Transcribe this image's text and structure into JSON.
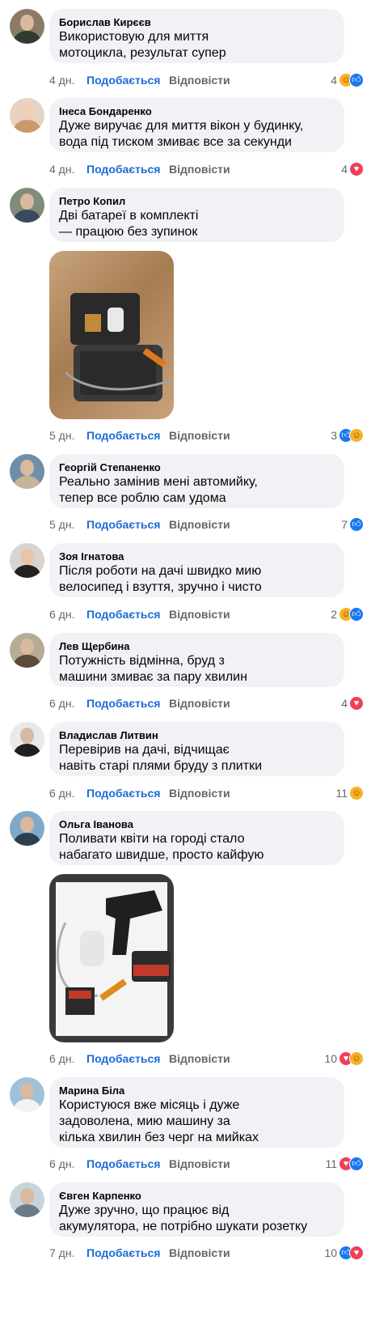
{
  "actions": {
    "like": "Подобається",
    "reply": "Відповісти"
  },
  "colors": {
    "link": "#1e6bd6",
    "bubble": "#f0f2f5",
    "meta": "#65676b",
    "like": "#1877f2",
    "love": "#f33e58",
    "care": "#f7b125"
  },
  "comments": [
    {
      "author": "Борислав Кирєєв",
      "lines": [
        "Використовую для миття",
        "мотоцикла, результат супер"
      ],
      "time": "4 дн.",
      "count": "4",
      "reactions": [
        "care-icon",
        "like-icon"
      ]
    },
    {
      "author": "Інеса Бондаренко",
      "lines": [
        "Дуже виручає для миття вікон у будинку,",
        "вода під тиском змиває все за секунди"
      ],
      "time": "4 дн.",
      "count": "4",
      "reactions": [
        "love-icon"
      ]
    },
    {
      "author": "Петро Копил",
      "lines": [
        "Дві батареї в комплекті",
        "— працюю без зупинок"
      ],
      "time": "5 дн.",
      "count": "3",
      "reactions": [
        "like-icon",
        "care-icon"
      ],
      "photo": "photo-case-with-pressure-washer"
    },
    {
      "author": "Георгій Степаненко",
      "lines": [
        "Реально замінив мені автомийку,",
        "тепер все роблю сам удома"
      ],
      "time": "5 дн.",
      "count": "7",
      "reactions": [
        "like-icon"
      ]
    },
    {
      "author": "Зоя Ігнатова",
      "lines": [
        "Після роботи на дачі швидко мию",
        "велосипед і взуття, зручно і чисто"
      ],
      "time": "6 дн.",
      "count": "2",
      "reactions": [
        "care-icon",
        "like-icon"
      ]
    },
    {
      "author": "Лев Щербина",
      "lines": [
        "Потужність відмінна, бруд з",
        "машини змиває за пару хвилин"
      ],
      "time": "6 дн.",
      "count": "4",
      "reactions": [
        "love-icon"
      ]
    },
    {
      "author": "Владислав Литвин",
      "lines": [
        "Перевірив на дачі, відчищає",
        "навіть старі плями бруду з плитки"
      ],
      "time": "6 дн.",
      "count": "11",
      "reactions": [
        "care-icon"
      ]
    },
    {
      "author": "Ольга Іванова",
      "lines": [
        "Поливати квіти на городі стало",
        "набагато швидше, просто кайфую"
      ],
      "time": "6 дн.",
      "count": "10",
      "reactions": [
        "love-icon",
        "care-icon"
      ],
      "photo": "photo-washer-kit-with-batteries"
    },
    {
      "author": "Марина Біла",
      "lines": [
        "Користуюся вже місяць і дуже",
        "задоволена, мию машину за",
        "кілька хвилин без черг на мийках"
      ],
      "time": "6 дн.",
      "count": "11",
      "reactions": [
        "love-icon",
        "like-icon"
      ]
    },
    {
      "author": "Євген Карпенко",
      "lines": [
        "Дуже зручно, що працює від",
        "акумулятора, не потрібно шукати розетку"
      ],
      "time": "7 дн.",
      "count": "10",
      "reactions": [
        "like-icon",
        "love-icon"
      ]
    }
  ]
}
